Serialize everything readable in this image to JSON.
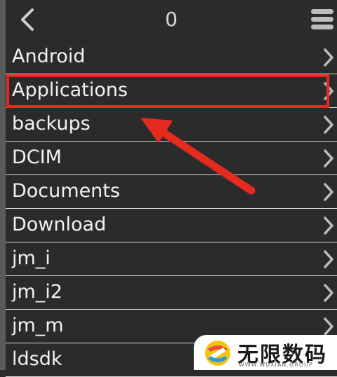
{
  "header": {
    "title": "0",
    "back_icon": "chevron-left-icon",
    "menu_icon": "hamburger-menu-icon"
  },
  "folders": [
    {
      "label": "Android"
    },
    {
      "label": "Applications"
    },
    {
      "label": "backups"
    },
    {
      "label": "DCIM"
    },
    {
      "label": "Documents"
    },
    {
      "label": "Download"
    },
    {
      "label": "jm_i"
    },
    {
      "label": "jm_i2"
    },
    {
      "label": "jm_m"
    },
    {
      "label": "ldsdk"
    }
  ],
  "annotation": {
    "highlighted_item": "Applications",
    "highlight_color": "#e52a20"
  },
  "watermark": {
    "text": "无限数码",
    "subtext": "WWW.WUXIAN.GROUP"
  },
  "colors": {
    "background": "#2b2b2b",
    "text": "#f2f2f2",
    "divider": "#d8d8d8"
  }
}
